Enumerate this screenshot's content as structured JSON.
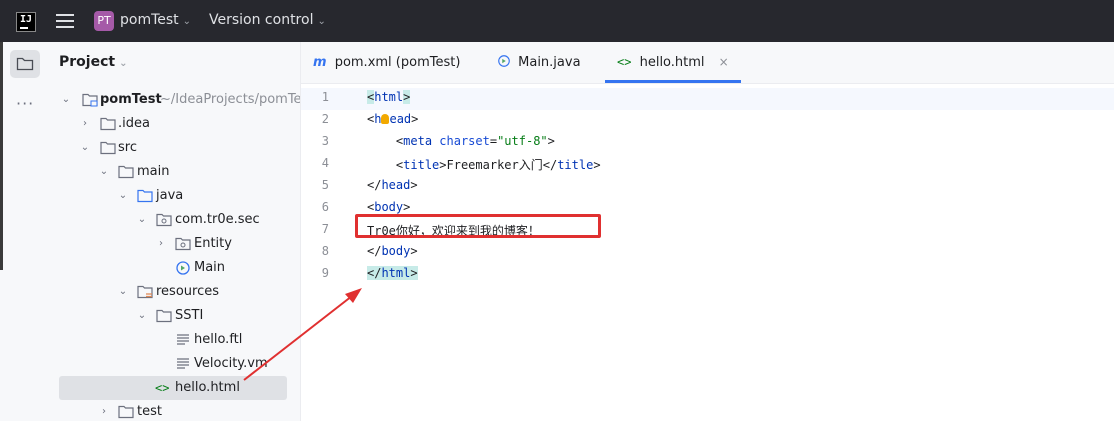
{
  "titlebar": {
    "logo_text": "IJ",
    "project_badge": "PT",
    "project_name": "pomTest",
    "vcs_label": "Version control"
  },
  "project_panel": {
    "title": "Project",
    "tree": [
      {
        "label": "pomTest",
        "path": "~/IdeaProjects/pomTe",
        "icon": "module-folder-icon",
        "expanded": true
      },
      {
        "label": ".idea",
        "icon": "folder-icon",
        "expanded": false
      },
      {
        "label": "src",
        "icon": "folder-icon",
        "expanded": true
      },
      {
        "label": "main",
        "icon": "folder-icon",
        "expanded": true
      },
      {
        "label": "java",
        "icon": "source-folder-icon",
        "expanded": true
      },
      {
        "label": "com.tr0e.sec",
        "icon": "package-icon",
        "expanded": true
      },
      {
        "label": "Entity",
        "icon": "package-icon",
        "expanded": false
      },
      {
        "label": "Main",
        "icon": "java-class-icon"
      },
      {
        "label": "resources",
        "icon": "resources-folder-icon",
        "expanded": true
      },
      {
        "label": "SSTI",
        "icon": "folder-icon",
        "expanded": true
      },
      {
        "label": "hello.ftl",
        "icon": "text-file-icon"
      },
      {
        "label": "Velocity.vm",
        "icon": "text-file-icon"
      },
      {
        "label": "hello.html",
        "icon": "html-file-icon",
        "selected": true
      },
      {
        "label": "test",
        "icon": "folder-icon",
        "expanded": false
      }
    ]
  },
  "tabs": [
    {
      "label": "pom.xml (pomTest)",
      "icon": "maven-icon"
    },
    {
      "label": "Main.java",
      "icon": "java-class-icon"
    },
    {
      "label": "hello.html",
      "icon": "html-file-icon",
      "active": true,
      "close": "×"
    }
  ],
  "editor": {
    "line_numbers": [
      "1",
      "2",
      "3",
      "4",
      "5",
      "6",
      "7",
      "8",
      "9"
    ],
    "lines": {
      "l1": {
        "open": "<",
        "tag": "html",
        "close": ">"
      },
      "l2": {
        "open": "<",
        "tag_a": "h",
        "tag_b": "ead",
        "close": ">"
      },
      "l3": {
        "indent": "    ",
        "open": "<",
        "tag": "meta",
        "attr": " charset",
        "eq": "=",
        "value": "\"utf-8\"",
        "close": ">"
      },
      "l4": {
        "indent": "    ",
        "open": "<",
        "tag": "title",
        "close": ">",
        "text": "Freemarker入门",
        "end_open": "</",
        "end_tag": "title",
        "end_close": ">"
      },
      "l5": {
        "open": "</",
        "tag": "head",
        "close": ">"
      },
      "l6": {
        "open": "<",
        "tag": "body",
        "close": ">"
      },
      "l7": {
        "text": "Tr0e你好，欢迎来到我的博客！"
      },
      "l8": {
        "open": "</",
        "tag": "body",
        "close": ">"
      },
      "l9": {
        "open": "</",
        "tag": "html",
        "close": ">"
      }
    }
  },
  "colors": {
    "annotation_red": "#e03030",
    "tab_accent": "#3574f0",
    "brace_highlight": "#c7ebe8"
  }
}
